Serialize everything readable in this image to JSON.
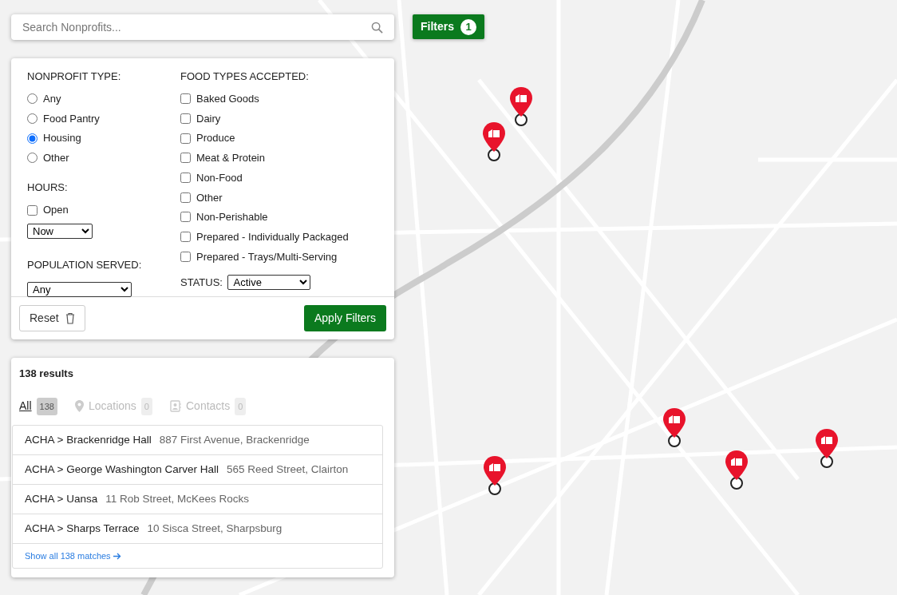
{
  "search": {
    "placeholder": "Search Nonprofits..."
  },
  "filters_button": {
    "label": "Filters",
    "count": "1"
  },
  "filters": {
    "nonprofit_type": {
      "title": "NONPROFIT TYPE:",
      "options": [
        {
          "label": "Any",
          "selected": false
        },
        {
          "label": "Food Pantry",
          "selected": false
        },
        {
          "label": "Housing",
          "selected": true
        },
        {
          "label": "Other",
          "selected": false
        }
      ]
    },
    "hours": {
      "title": "HOURS:",
      "open": {
        "label": "Open",
        "checked": false
      },
      "when": "Now"
    },
    "population_served": {
      "title": "POPULATION SERVED:",
      "value": "Any"
    },
    "food_types": {
      "title": "FOOD TYPES ACCEPTED:",
      "options": [
        {
          "label": "Baked Goods",
          "checked": false
        },
        {
          "label": "Dairy",
          "checked": false
        },
        {
          "label": "Produce",
          "checked": false
        },
        {
          "label": "Meat & Protein",
          "checked": false
        },
        {
          "label": "Non-Food",
          "checked": false
        },
        {
          "label": "Other",
          "checked": false
        },
        {
          "label": "Non-Perishable",
          "checked": false
        },
        {
          "label": "Prepared - Individually Packaged",
          "checked": false
        },
        {
          "label": "Prepared - Trays/Multi-Serving",
          "checked": false
        }
      ]
    },
    "status": {
      "title": "STATUS:",
      "value": "Active"
    },
    "reset": "Reset",
    "apply": "Apply Filters"
  },
  "results": {
    "title": "138 results",
    "tabs": [
      {
        "kind": "all",
        "label": "All",
        "count": "138",
        "selected": true
      },
      {
        "kind": "locations",
        "label": "Locations",
        "count": "0",
        "selected": false
      },
      {
        "kind": "contacts",
        "label": "Contacts",
        "count": "0",
        "selected": false
      }
    ],
    "items": [
      {
        "name": "ACHA > Brackenridge Hall",
        "address": "887 First Avenue, Brackenridge"
      },
      {
        "name": "ACHA > George Washington Carver Hall",
        "address": "565 Reed Street, Clairton"
      },
      {
        "name": "ACHA > Uansa",
        "address": "11 Rob Street, McKees Rocks"
      },
      {
        "name": "ACHA > Sharps Terrace",
        "address": "10 Sisca Street, Sharpsburg"
      }
    ],
    "show_all": "Show all 138 matches"
  }
}
